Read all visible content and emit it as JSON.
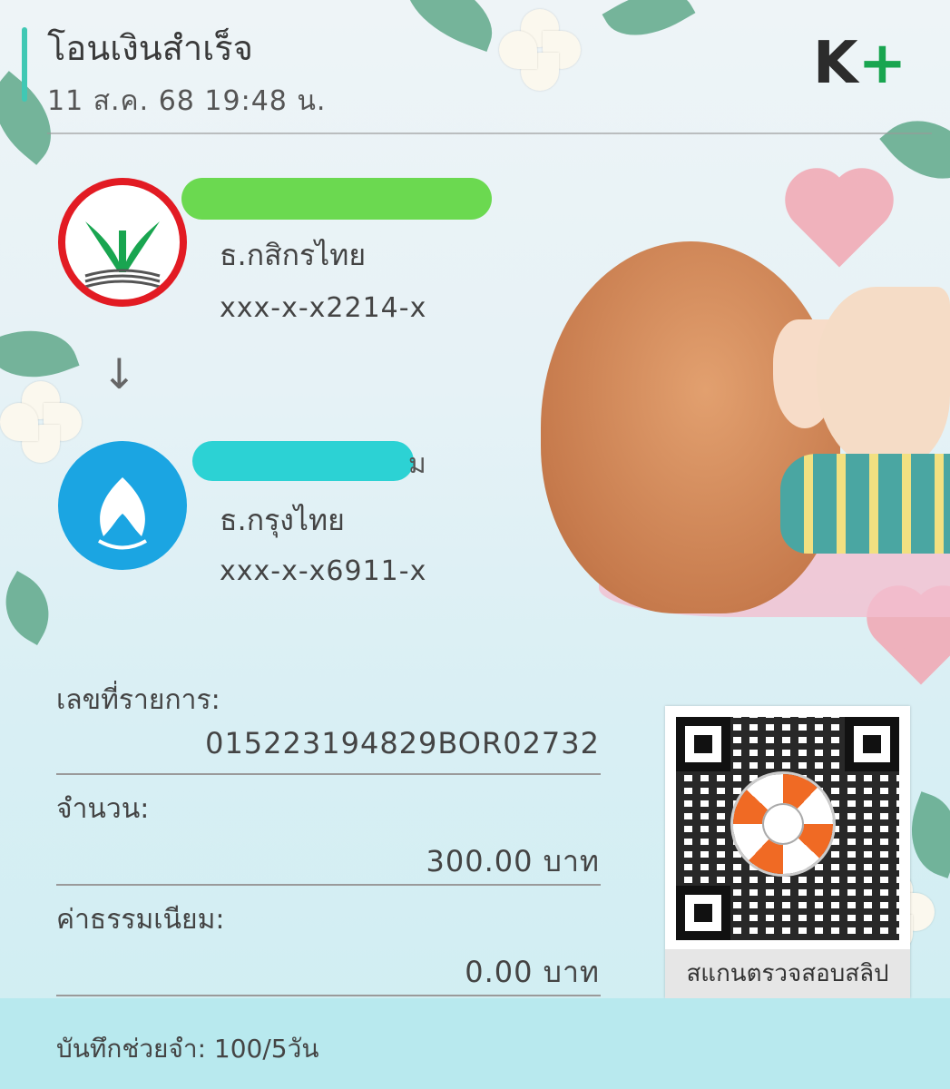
{
  "header": {
    "title": "โอนเงินสำเร็จ",
    "datetime": "11 ส.ค. 68  19:48 น.",
    "logo_text": "K",
    "logo_plus": "+"
  },
  "sender": {
    "bank_name": "ธ.กสิกรไทย",
    "account": "xxx-x-x2214-x",
    "bank_color": "#e21b23",
    "name_redaction_color": "#6bd950"
  },
  "receiver": {
    "name_visible_tail": "ม",
    "bank_name": "ธ.กรุงไทย",
    "account": "xxx-x-x6911-x",
    "bank_color": "#1ba5e2",
    "name_redaction_color": "#2cd2d4"
  },
  "details": {
    "ref_label": "เลขที่รายการ:",
    "ref_value": "015223194829BOR02732",
    "amount_label": "จำนวน:",
    "amount_value": "300.00 บาท",
    "fee_label": "ค่าธรรมเนียม:",
    "fee_value": "0.00 บาท"
  },
  "qr": {
    "caption": "สแกนตรวจสอบสลิป"
  },
  "footer": {
    "memo": "บันทึกช่วยจำ: 100/5วัน"
  },
  "colors": {
    "accent": "#40c8b4",
    "kplus_green": "#19a550"
  }
}
